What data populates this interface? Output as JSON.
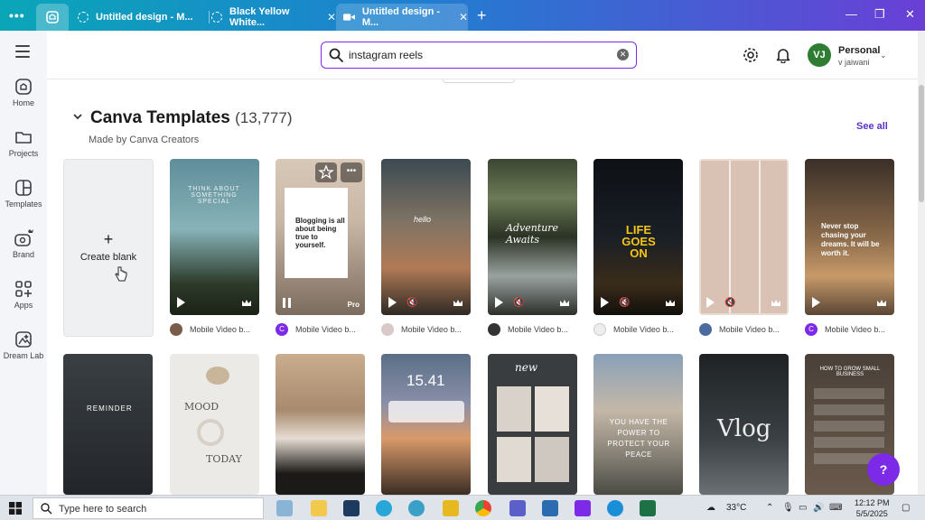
{
  "browser": {
    "tabs": [
      {
        "label": "Untitled design - M..."
      },
      {
        "label": "Black Yellow White..."
      },
      {
        "label": "Untitled design - M..."
      }
    ],
    "close_glyph": "✕",
    "new_tab_glyph": "+",
    "menu_glyph": "•••",
    "minimize_glyph": "—",
    "restore_glyph": "❐",
    "window_close_glyph": "✕"
  },
  "sidebar": {
    "items": [
      {
        "label": "Home",
        "icon": "home-icon"
      },
      {
        "label": "Projects",
        "icon": "folder-icon"
      },
      {
        "label": "Templates",
        "icon": "templates-icon"
      },
      {
        "label": "Brand",
        "icon": "brand-icon"
      },
      {
        "label": "Apps",
        "icon": "apps-icon"
      },
      {
        "label": "Dream Lab",
        "icon": "dream-lab-icon"
      }
    ]
  },
  "header": {
    "search": {
      "value": "instagram reels",
      "clear_glyph": "✕"
    },
    "account": {
      "initials": "VJ",
      "name": "Personal",
      "username": "v jaiwani",
      "chevron": "⌄"
    }
  },
  "section": {
    "title": "Canva Templates",
    "count": "(13,777)",
    "subtitle": "Made by Canva Creators",
    "see_all": "See all",
    "create_blank": {
      "plus": "+",
      "label": "Create blank"
    }
  },
  "cards_row1": [
    {
      "meta": "Mobile Video b...",
      "avatar_color": "#7a5c4a",
      "text": "THINK ABOUT SOMETHING SPECIAL"
    },
    {
      "meta": "Mobile Video b...",
      "avatar_color": "#7d2ae8",
      "avatar_letter": "C",
      "text": "Blogging is all about being true to yourself.",
      "badge": "Pro"
    },
    {
      "meta": "Mobile Video b...",
      "avatar_color": "#d9c9c9",
      "text": "hello"
    },
    {
      "meta": "Mobile Video b...",
      "avatar_color": "#333333",
      "text": "Adventure Awaits"
    },
    {
      "meta": "Mobile Video b...",
      "avatar_color": "#eeeeee",
      "text": "LIFE GOES ON"
    },
    {
      "meta": "Mobile Video b...",
      "avatar_color": "#4a6aa0",
      "text": ""
    },
    {
      "meta": "Mobile Video b...",
      "avatar_color": "#7d2ae8",
      "avatar_letter": "C",
      "text": "Never stop chasing your dreams. It will be worth it."
    }
  ],
  "cards_row2": [
    {
      "text": "REMINDER"
    },
    {
      "text": "MOOD",
      "text2": "TODAY"
    },
    {
      "text": ""
    },
    {
      "text": "15.41"
    },
    {
      "text": "new"
    },
    {
      "text": "YOU HAVE THE POWER TO PROTECT YOUR PEACE"
    },
    {
      "text": "Vlog"
    },
    {
      "text": "HOW TO GROW SMALL BUSINESS"
    }
  ],
  "help": {
    "label": "?"
  },
  "taskbar": {
    "search_placeholder": "Type here to search",
    "weather": "33°C",
    "time": "12:12 PM",
    "date": "5/5/2025"
  }
}
